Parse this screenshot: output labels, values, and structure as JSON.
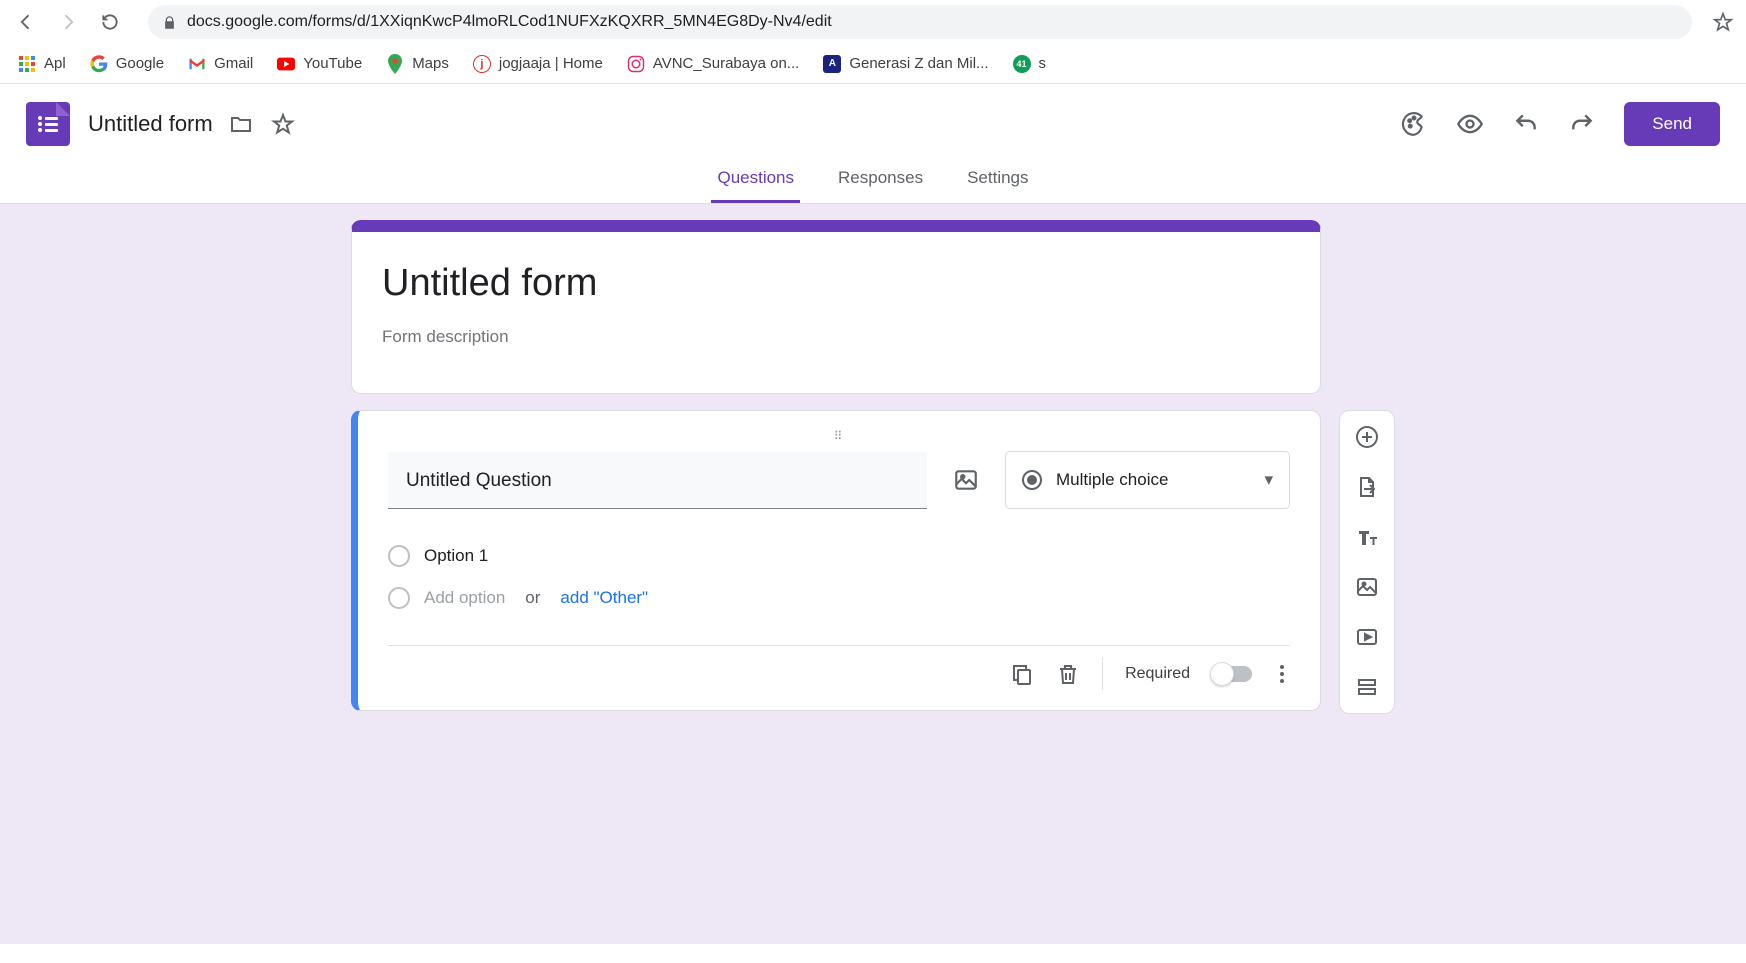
{
  "browser": {
    "url": "docs.google.com/forms/d/1XXiqnKwcP4lmoRLCod1NUFXzKQXRR_5MN4EG8Dy-Nv4/edit"
  },
  "bookmarks": [
    {
      "label": "Apl"
    },
    {
      "label": "Google"
    },
    {
      "label": "Gmail"
    },
    {
      "label": "YouTube"
    },
    {
      "label": "Maps"
    },
    {
      "label": "jogjaaja | Home"
    },
    {
      "label": "AVNC_Surabaya on..."
    },
    {
      "label": "Generasi Z dan Mil..."
    },
    {
      "label": "s"
    }
  ],
  "header": {
    "doc_title": "Untitled form",
    "send_label": "Send"
  },
  "tabs": {
    "questions": "Questions",
    "responses": "Responses",
    "settings": "Settings"
  },
  "form": {
    "title": "Untitled form",
    "description_placeholder": "Form description"
  },
  "question": {
    "title": "Untitled Question",
    "type_label": "Multiple choice",
    "option1": "Option 1",
    "add_option": "Add option",
    "or": "or",
    "add_other": "add \"Other\"",
    "required_label": "Required"
  }
}
